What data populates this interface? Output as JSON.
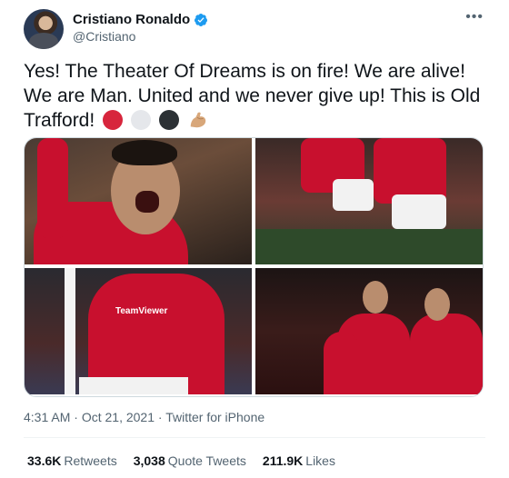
{
  "author": {
    "name": "Cristiano Ronaldo",
    "handle": "@Cristiano",
    "more": "•••"
  },
  "tweet": {
    "text": "Yes! The Theater Of Dreams is on fire! We are alive! We are Man. United and we never give up! This is Old Trafford!",
    "emojis": [
      "red-circle",
      "white-circle",
      "black-circle",
      "flexed-biceps"
    ]
  },
  "meta": {
    "time": "4:31 AM",
    "sep1": "·",
    "date": "Oct 21, 2021",
    "sep2": "·",
    "source": "Twitter for iPhone"
  },
  "stats": {
    "retweets_count": "33.6K",
    "retweets_label": "Retweets",
    "quotes_count": "3,038",
    "quotes_label": "Quote Tweets",
    "likes_count": "211.9K",
    "likes_label": "Likes"
  },
  "colors": {
    "text": "#0f1419",
    "secondary": "#536471",
    "verified": "#1d9bf0",
    "united_red": "#c8102e"
  }
}
